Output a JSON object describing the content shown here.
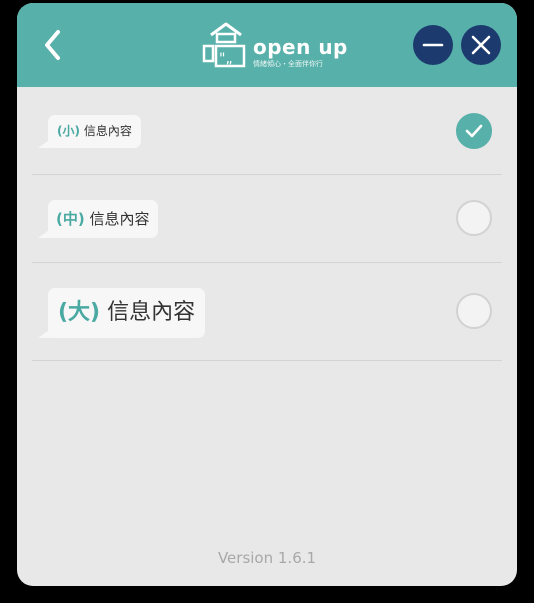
{
  "header": {
    "brand_name": "open up",
    "brand_tagline": "情緒傾心・全面伴你行",
    "colors": {
      "bar": "#57b0a9",
      "window_buttons": "#1c3a6e",
      "accent_text": "#4aa9a2"
    }
  },
  "options": [
    {
      "size_tag": "(小)",
      "text": "信息內容",
      "selected": true
    },
    {
      "size_tag": "(中)",
      "text": "信息內容",
      "selected": false
    },
    {
      "size_tag": "(大)",
      "text": "信息內容",
      "selected": false
    }
  ],
  "footer": {
    "version": "Version 1.6.1"
  }
}
